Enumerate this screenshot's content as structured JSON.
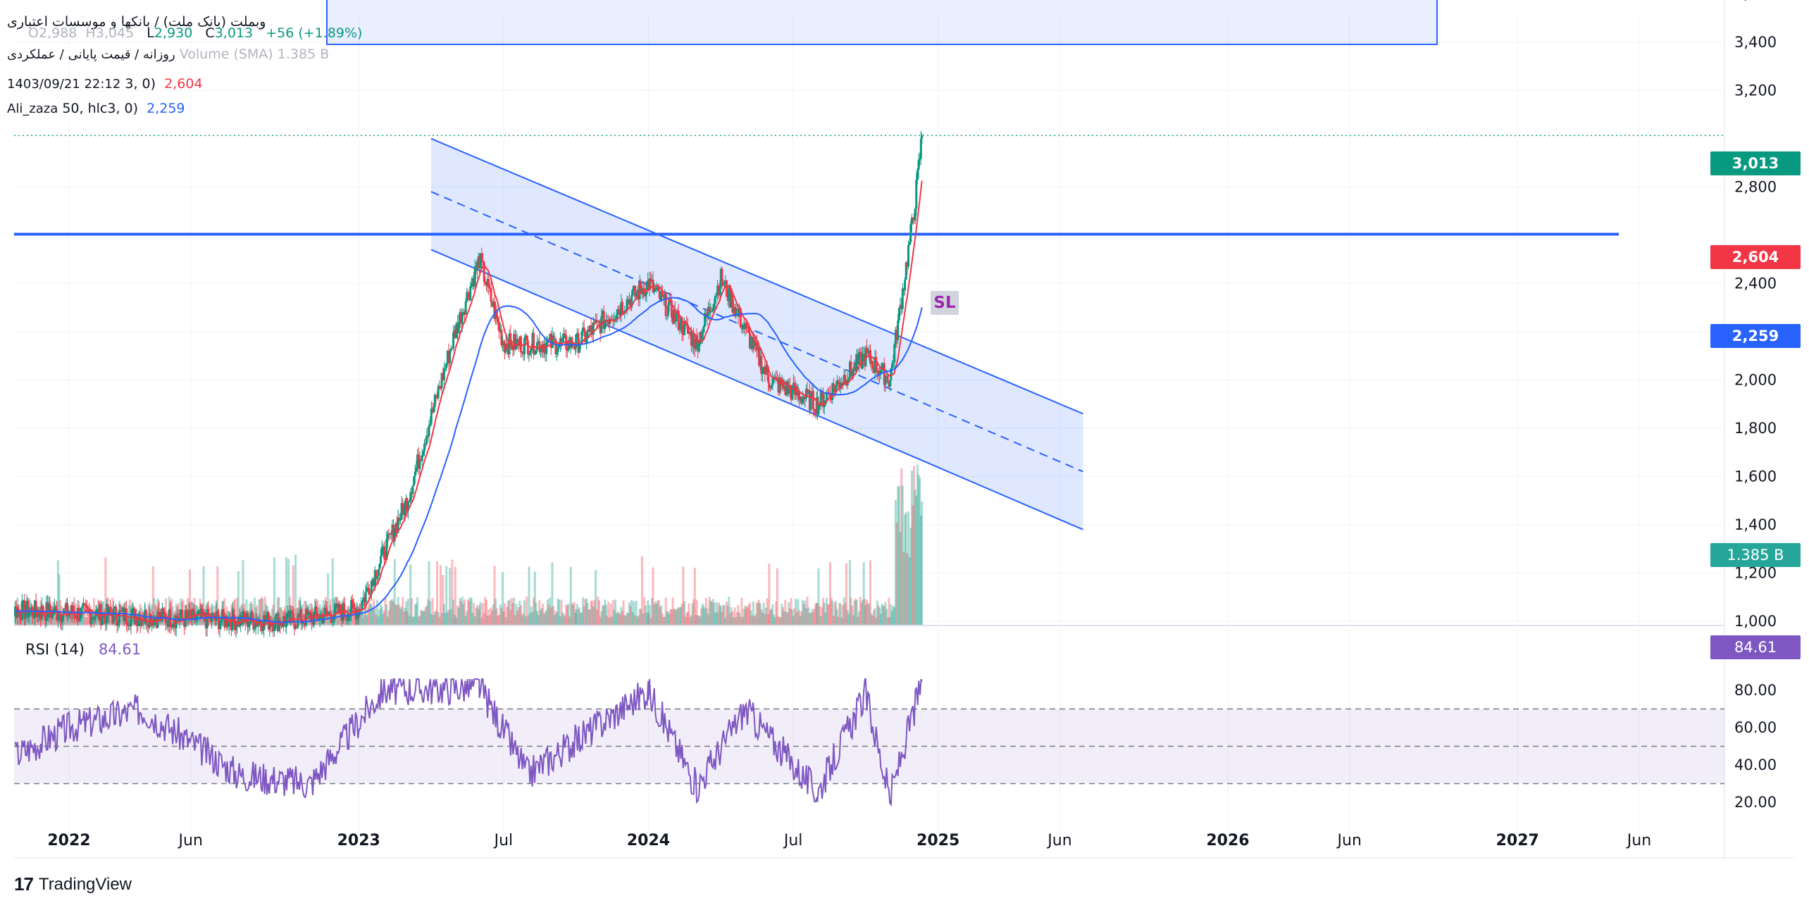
{
  "header": {
    "symbol_line": "وبملت (بانک ملت) / بانکها و موسسات اعتباری",
    "timeframe_line": "روزانه / قیمت پایانی / عملکردی",
    "ohlc": {
      "o_label": "O",
      "o": "2,988",
      "h_label": "H",
      "h": "3,045",
      "l_label": "L",
      "l": "2,930",
      "c_label": "C",
      "c": "3,013",
      "change": "+56 (+1.89%)"
    },
    "volume_label": "Volume (SMA)",
    "volume_value": "1.385 B",
    "timestamp": "1403/09/21 22:12",
    "ma1_params": "3, 0)",
    "ma1_value": "2,604",
    "author": "Ali_zaza",
    "ma2_params": "50, hlc3, 0)",
    "ma2_value": "2,259"
  },
  "price_tags": {
    "last": "3,013",
    "ma_fast": "2,604",
    "ma_slow": "2,259",
    "volume": "1.385 B",
    "rsi": "84.61"
  },
  "annotations": {
    "sl": "SL"
  },
  "rsi": {
    "label": "RSI (14)",
    "value": "84.61"
  },
  "brand": {
    "name": "TradingView"
  },
  "colors": {
    "up": "#089981",
    "down": "#f23645",
    "channel": "#2962ff",
    "rsi": "#7e57c2",
    "ma_fast": "#f23645",
    "ma_slow": "#2962ff"
  },
  "chart_data": [
    {
      "type": "candlestick",
      "title": "وبملت (بانک ملت) / بانکها و موسسات اعتباری",
      "price_axis_ticks": [
        "3,600",
        "3,400",
        "3,200",
        "2,800",
        "2,400",
        "2,200",
        "2,000",
        "1,800",
        "1,600",
        "1,400",
        "1,200",
        "1,000"
      ],
      "ylim": [
        1000,
        3650
      ],
      "time_axis_ticks": [
        "2022",
        "Jun",
        "2023",
        "Jul",
        "2024",
        "Jul",
        "2025",
        "Jun",
        "2026",
        "Jun",
        "2027",
        "Jun"
      ],
      "xlim": [
        "2021-11",
        "2027-09"
      ],
      "price_anchors": [
        {
          "date": "2021-10",
          "price": 1050
        },
        {
          "date": "2022-06",
          "price": 1010
        },
        {
          "date": "2022-10",
          "price": 1000
        },
        {
          "date": "2023-01",
          "price": 1050
        },
        {
          "date": "2023-03",
          "price": 1500
        },
        {
          "date": "2023-05",
          "price": 2200
        },
        {
          "date": "2023-06",
          "price": 2500
        },
        {
          "date": "2023-07",
          "price": 2150
        },
        {
          "date": "2023-10",
          "price": 2150
        },
        {
          "date": "2024-01",
          "price": 2400
        },
        {
          "date": "2024-03",
          "price": 2150
        },
        {
          "date": "2024-04",
          "price": 2420
        },
        {
          "date": "2024-06",
          "price": 2000
        },
        {
          "date": "2024-08",
          "price": 1900
        },
        {
          "date": "2024-10",
          "price": 2100
        },
        {
          "date": "2024-11",
          "price": 2000
        },
        {
          "date": "2024-12",
          "price": 2700
        },
        {
          "date": "2024-12-11",
          "price": 3013
        }
      ],
      "horizontal_level": 2604,
      "last_price": 3013,
      "moving_averages": [
        {
          "name": "MA",
          "value": 2604
        },
        {
          "name": "MA",
          "value": 2259
        }
      ],
      "parallel_channel": {
        "start": "2023-04",
        "end": "2025-07",
        "upper": [
          3000,
          1860
        ],
        "middle": [
          2780,
          1620
        ],
        "lower": [
          2540,
          1380
        ]
      },
      "volume_last": "1.385 B"
    },
    {
      "type": "line",
      "title": "RSI (14)",
      "value": 84.61,
      "axis_ticks": [
        "80.00",
        "60.00",
        "40.00",
        "20.00"
      ],
      "ylim": [
        15,
        88
      ],
      "bands": {
        "upper": 70,
        "middle": 50,
        "lower": 30
      },
      "anchors": [
        {
          "date": "2021-10",
          "value": 40
        },
        {
          "date": "2022-01",
          "value": 60
        },
        {
          "date": "2022-04",
          "value": 70
        },
        {
          "date": "2022-08",
          "value": 35
        },
        {
          "date": "2022-11",
          "value": 30
        },
        {
          "date": "2023-02",
          "value": 80
        },
        {
          "date": "2023-06",
          "value": 82
        },
        {
          "date": "2023-08",
          "value": 35
        },
        {
          "date": "2024-01",
          "value": 80
        },
        {
          "date": "2024-03",
          "value": 28
        },
        {
          "date": "2024-05",
          "value": 70
        },
        {
          "date": "2024-08",
          "value": 25
        },
        {
          "date": "2024-10",
          "value": 78
        },
        {
          "date": "2024-11",
          "value": 22
        },
        {
          "date": "2024-12-11",
          "value": 84.61
        }
      ]
    }
  ]
}
